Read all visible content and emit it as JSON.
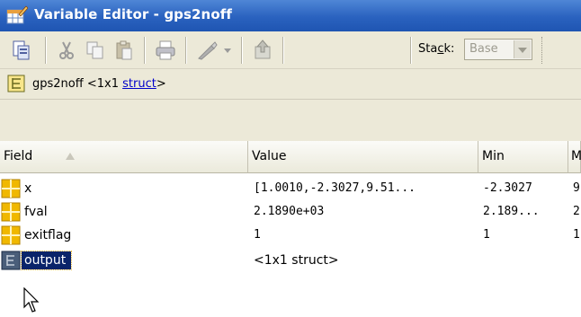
{
  "window": {
    "title": "Variable Editor - gps2noff",
    "app_icon": "variable-editor-icon"
  },
  "toolbar": {
    "buttons": [
      {
        "name": "new-from-selection-icon"
      },
      {
        "name": "cut-icon"
      },
      {
        "name": "copy-icon"
      },
      {
        "name": "paste-icon"
      },
      {
        "name": "print-icon"
      },
      {
        "name": "plot-selection-icon"
      },
      {
        "name": "plot-dropdown-icon"
      },
      {
        "name": "go-up-icon"
      }
    ],
    "stack_label_prefix": "Sta",
    "stack_label_underlined": "c",
    "stack_label_suffix": "k:",
    "stack_value": "Base"
  },
  "path": {
    "variable": "gps2noff",
    "size_text": " <1x1 ",
    "class_link": "struct",
    "closing": ">"
  },
  "table": {
    "columns": [
      {
        "label": "Field"
      },
      {
        "label": "Value"
      },
      {
        "label": "Min"
      },
      {
        "label": "M"
      }
    ],
    "rows": [
      {
        "field": "x",
        "value": "[1.0010,-2.3027,9.51...",
        "min": "-2.3027",
        "max": "9"
      },
      {
        "field": "fval",
        "value": "2.1890e+03",
        "min": "2.189...",
        "max": "2"
      },
      {
        "field": "exitflag",
        "value": "1",
        "min": "1",
        "max": "1"
      },
      {
        "field": "output",
        "value": "<1x1 struct>",
        "min": "",
        "max": ""
      }
    ]
  },
  "colors": {
    "titlebar": "#2a62bf",
    "chrome": "#ece9d8",
    "selection": "#0a246a",
    "link": "#0000cc"
  }
}
